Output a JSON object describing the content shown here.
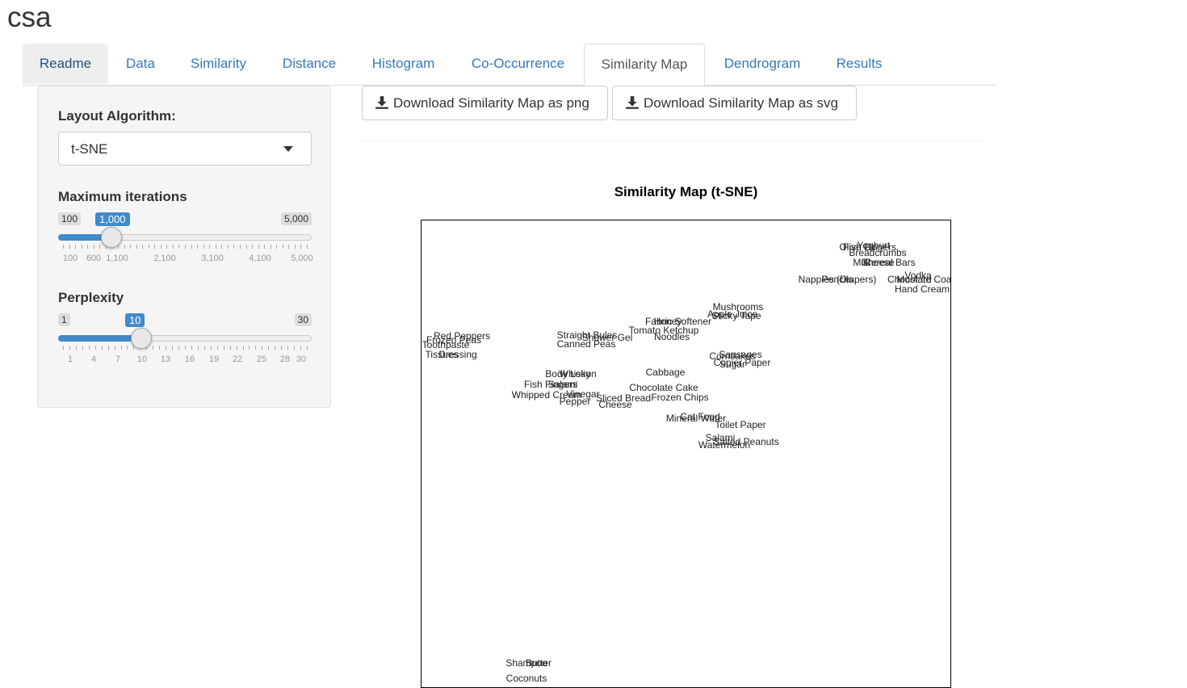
{
  "app_title": "csa",
  "tabs": [
    {
      "label": "Readme",
      "state": "hover"
    },
    {
      "label": "Data",
      "state": "normal"
    },
    {
      "label": "Similarity",
      "state": "normal"
    },
    {
      "label": "Distance",
      "state": "normal"
    },
    {
      "label": "Histogram",
      "state": "normal"
    },
    {
      "label": "Co-Occurrence",
      "state": "normal"
    },
    {
      "label": "Similarity Map",
      "state": "active"
    },
    {
      "label": "Dendrogram",
      "state": "normal"
    },
    {
      "label": "Results",
      "state": "normal"
    }
  ],
  "sidebar": {
    "layout_label": "Layout Algorithm:",
    "layout_value": "t-SNE",
    "max_iter": {
      "label": "Maximum iterations",
      "min": 100,
      "max": 5000,
      "value": 1000,
      "min_label": "100",
      "max_label": "5,000",
      "value_label": "1,000",
      "tick_labels": [
        "100",
        "600",
        "1,100",
        "2,100",
        "3,100",
        "4,100",
        "5,000"
      ]
    },
    "perplexity": {
      "label": "Perplexity",
      "min": 1,
      "max": 30,
      "value": 10,
      "min_label": "1",
      "max_label": "30",
      "value_label": "10",
      "tick_labels": [
        "1",
        "4",
        "7",
        "10",
        "13",
        "16",
        "19",
        "22",
        "25",
        "28",
        "30"
      ]
    }
  },
  "buttons": {
    "png": "Download Similarity Map as png",
    "svg": "Download Similarity Map as svg"
  },
  "plot": {
    "title": "Similarity Map (t-SNE)",
    "labels": [
      {
        "t": "Yoghurt"
      },
      {
        "t": "Olive Oil"
      },
      {
        "t": "Fish Fingers"
      },
      {
        "t": "Breadcrumbs"
      },
      {
        "t": "Milk"
      },
      {
        "t": "Cereal Bars"
      },
      {
        "t": "Cheese"
      },
      {
        "t": "Vodka"
      },
      {
        "t": "Nappies (Diapers)"
      },
      {
        "t": "Pencils"
      },
      {
        "t": "Mustard"
      },
      {
        "t": "Chocolate Coated"
      },
      {
        "t": "Hand Cream"
      },
      {
        "t": "Mushrooms"
      },
      {
        "t": "Apple Juice"
      },
      {
        "t": "Sticky Tape"
      },
      {
        "t": "Fabric Softener"
      },
      {
        "t": "Honey"
      },
      {
        "t": "Tomato Ketchup"
      },
      {
        "t": "Noodles"
      },
      {
        "t": "Red Peppers"
      },
      {
        "t": "Frozen Peas"
      },
      {
        "t": "Toothpaste"
      },
      {
        "t": "Tissues"
      },
      {
        "t": "Dressing"
      },
      {
        "t": "Straight Bules"
      },
      {
        "t": "Shower Gel"
      },
      {
        "t": "Canned Peas"
      },
      {
        "t": "Sausages"
      },
      {
        "t": "Cornflakes"
      },
      {
        "t": "Sugar"
      },
      {
        "t": "Copier Paper"
      },
      {
        "t": "Body Lotion"
      },
      {
        "t": "Whisky"
      },
      {
        "t": "Cabbage"
      },
      {
        "t": "Chocolate Cake"
      },
      {
        "t": "Fish Fingers"
      },
      {
        "t": "Salami"
      },
      {
        "t": "Whipped Cream"
      },
      {
        "t": "Vinegar"
      },
      {
        "t": "Pepper"
      },
      {
        "t": "Sliced Bread"
      },
      {
        "t": "Cheese"
      },
      {
        "t": "Frozen Chips"
      },
      {
        "t": "Cat Food"
      },
      {
        "t": "Mineral Water"
      },
      {
        "t": "Toilet Paper"
      },
      {
        "t": "Salami"
      },
      {
        "t": "Salted Peanuts"
      },
      {
        "t": "Watermelon"
      },
      {
        "t": "Shampoo"
      },
      {
        "t": "Butter"
      },
      {
        "t": "Coconuts"
      }
    ]
  }
}
